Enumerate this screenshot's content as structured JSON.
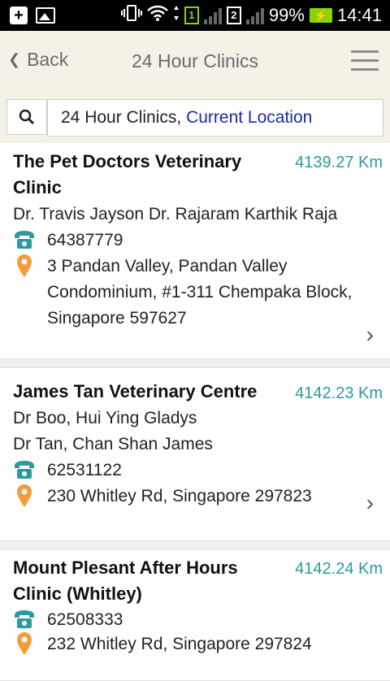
{
  "status_bar": {
    "sim1": "1",
    "sim2": "2",
    "battery": "99%",
    "time": "14:41"
  },
  "header": {
    "back_label": "Back",
    "title": "24 Hour Clinics"
  },
  "search": {
    "query": "24 Hour Clinics,",
    "location": "Current Location"
  },
  "clinics": [
    {
      "name_line1": "The Pet Doctors Veterinary",
      "name_line2": "Clinic",
      "distance": "4139.27 Km",
      "doctors_line1": "Dr. Travis Jayson Dr. Rajaram Karthik Raja",
      "phone": "64387779",
      "address_line1": "3 Pandan Valley, Pandan Valley",
      "address_line2": "Condominium, #1-311 Chempaka Block,",
      "address_line3": "Singapore 597627"
    },
    {
      "name_line1": "James Tan Veterinary Centre",
      "distance": "4142.23 Km",
      "doctors_line1": "Dr Boo, Hui Ying Gladys",
      "doctors_line2": "Dr Tan, Chan Shan James",
      "phone": "62531122",
      "address_line1": "230 Whitley Rd, Singapore 297823"
    },
    {
      "name_line1": "Mount Plesant After Hours",
      "name_line2": "Clinic (Whitley)",
      "distance": "4142.24 Km",
      "phone": "62508333",
      "address_line1": "232 Whitley Rd, Singapore 297824"
    }
  ],
  "colors": {
    "header_bg": "#f4f1e7",
    "distance": "#2b9aa0",
    "location_link": "#1a2aa8",
    "pin": "#f39c3c",
    "phone_icon": "#2b9aa0"
  }
}
